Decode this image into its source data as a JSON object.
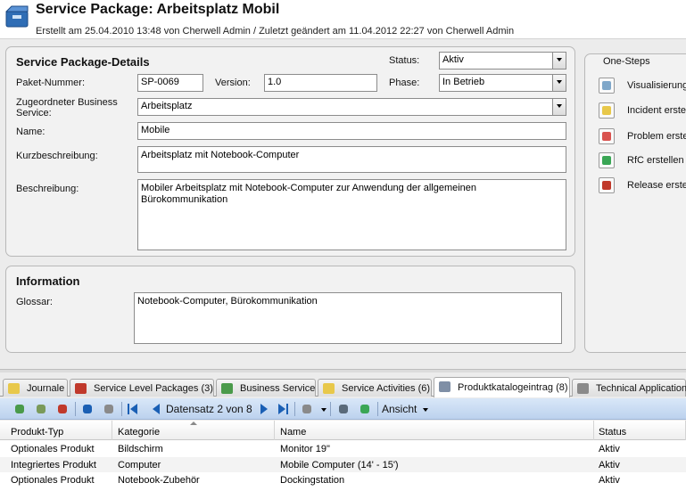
{
  "header": {
    "title": "Service Package: Arbeitsplatz Mobil",
    "subtitle": "Erstellt am 25.04.2010 13:48 von Cherwell Admin / Zuletzt geändert am 11.04.2012 22:27 von Cherwell Admin",
    "logo": "service-package-box-icon"
  },
  "details": {
    "title": "Service Package-Details",
    "paket_nummer_label": "Paket-Nummer:",
    "paket_nummer_value": "SP-0069",
    "version_label": "Version:",
    "version_value": "1.0",
    "status_label": "Status:",
    "status_value": "Aktiv",
    "phase_label": "Phase:",
    "phase_value": "In Betrieb",
    "business_service_label": "Zugeordneter Business Service:",
    "business_service_value": "Arbeitsplatz",
    "name_label": "Name:",
    "name_value": "Mobile",
    "kurz_label": "Kurzbeschreibung:",
    "kurz_value": "Arbeitsplatz mit Notebook-Computer",
    "beschreibung_label": "Beschreibung:",
    "beschreibung_value": "Mobiler Arbeitsplatz mit Notebook-Computer zur Anwendung der allgemeinen Bürokommunikation"
  },
  "information": {
    "title": "Information",
    "glossar_label": "Glossar:",
    "glossar_value": "Notebook-Computer, Bürokommunikation"
  },
  "one_steps": {
    "title": "One-Steps",
    "items": [
      {
        "label": "Visualisierung",
        "icon": "diagram-icon",
        "color": "#7fa7c9"
      },
      {
        "label": "Incident erstellen",
        "icon": "notepad-icon",
        "color": "#e8c84a"
      },
      {
        "label": "Problem erstellen",
        "icon": "traffic-light-icon",
        "color": "#d9534f"
      },
      {
        "label": "RfC erstellen",
        "icon": "recycle-icon",
        "color": "#3aa655"
      },
      {
        "label": "Release erstellen",
        "icon": "person-icon",
        "color": "#c0392b"
      }
    ]
  },
  "tabs": [
    {
      "label": "Journale",
      "icon": "journal-icon",
      "color": "#e8c84a"
    },
    {
      "label": "Service Level Packages (3)",
      "icon": "package-icon",
      "color": "#c0392b"
    },
    {
      "label": "Business Service",
      "icon": "chart-icon",
      "color": "#4a9a4a"
    },
    {
      "label": "Service Activities (6)",
      "icon": "activity-icon",
      "color": "#e8c84a"
    },
    {
      "label": "Produktkatalogeintrag (8)",
      "icon": "list-icon",
      "color": "#7f8fa6"
    },
    {
      "label": "Technical Application",
      "icon": "wrench-icon",
      "color": "#8a8a8a"
    }
  ],
  "toolbar": {
    "record_label": "Datensatz 2 von 8",
    "view_label": "Ansicht"
  },
  "table": {
    "columns": [
      "Produkt-Typ",
      "Kategorie",
      "Name",
      "Status"
    ],
    "rows": [
      [
        "Optionales Produkt",
        "Bildschirm",
        "Monitor 19\"",
        "Aktiv"
      ],
      [
        "Integriertes Produkt",
        "Computer",
        "Mobile Computer (14' - 15')",
        "Aktiv"
      ],
      [
        "Optionales Produkt",
        "Notebook-Zubehör",
        "Dockingstation",
        "Aktiv"
      ]
    ]
  }
}
